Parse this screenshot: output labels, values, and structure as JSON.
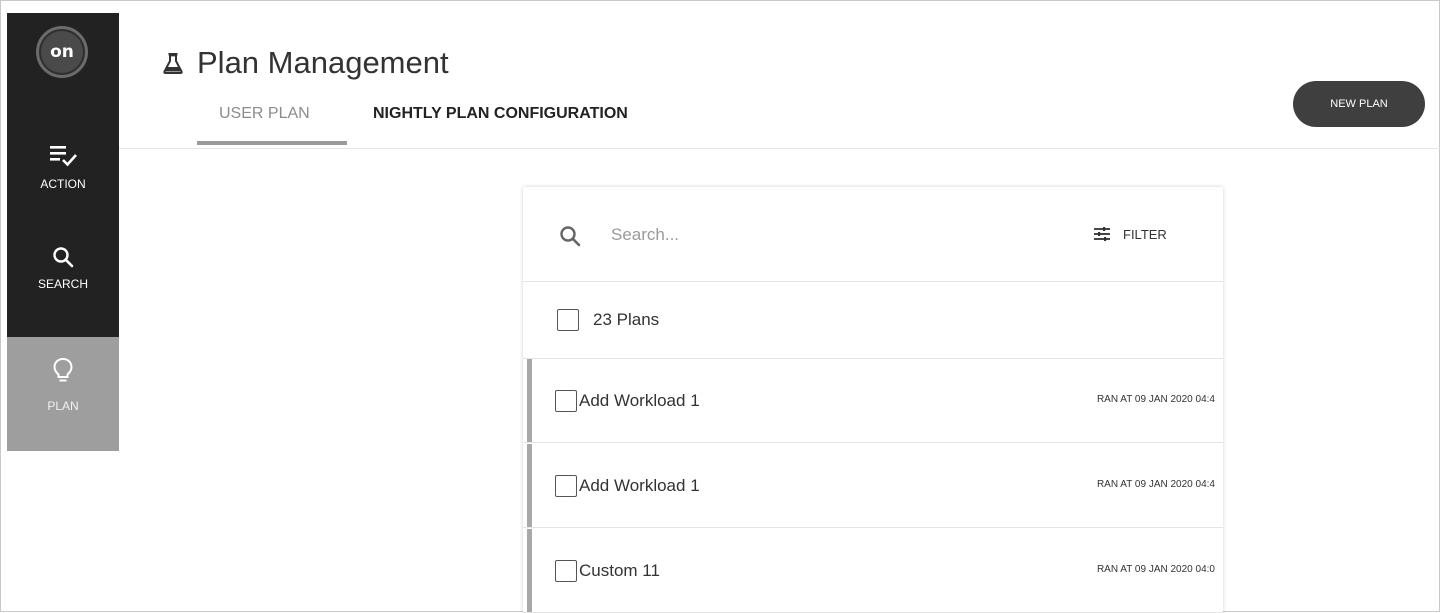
{
  "sidebar": {
    "logo_text": "on",
    "items": [
      {
        "label": "ACTION",
        "icon": "action-list-check-icon"
      },
      {
        "label": "SEARCH",
        "icon": "search-icon"
      },
      {
        "label": "PLAN",
        "icon": "lightbulb-icon",
        "active": true
      }
    ]
  },
  "header": {
    "icon": "flask-icon",
    "title": "Plan Management",
    "tabs": [
      {
        "label": "USER PLAN",
        "active": true
      },
      {
        "label": "NIGHTLY PLAN CONFIGURATION",
        "active": false
      }
    ],
    "new_plan_label": "NEW PLAN"
  },
  "panel": {
    "search": {
      "placeholder": "Search...",
      "value": ""
    },
    "filter_label": "FILTER",
    "select_all_label": "23 Plans",
    "plans": [
      {
        "name": "Add Workload 1",
        "status": "RAN AT 09 JAN 2020 04:4"
      },
      {
        "name": "Add Workload 1",
        "status": "RAN AT 09 JAN 2020 04:4"
      },
      {
        "name": "Custom 11",
        "status": "RAN AT 09 JAN 2020 04:0"
      }
    ]
  },
  "colors": {
    "sidebar_bg": "#222222",
    "sidebar_active": "#9e9e9e",
    "button_bg": "#3f3f3f",
    "row_accent": "#a8a8a8"
  }
}
